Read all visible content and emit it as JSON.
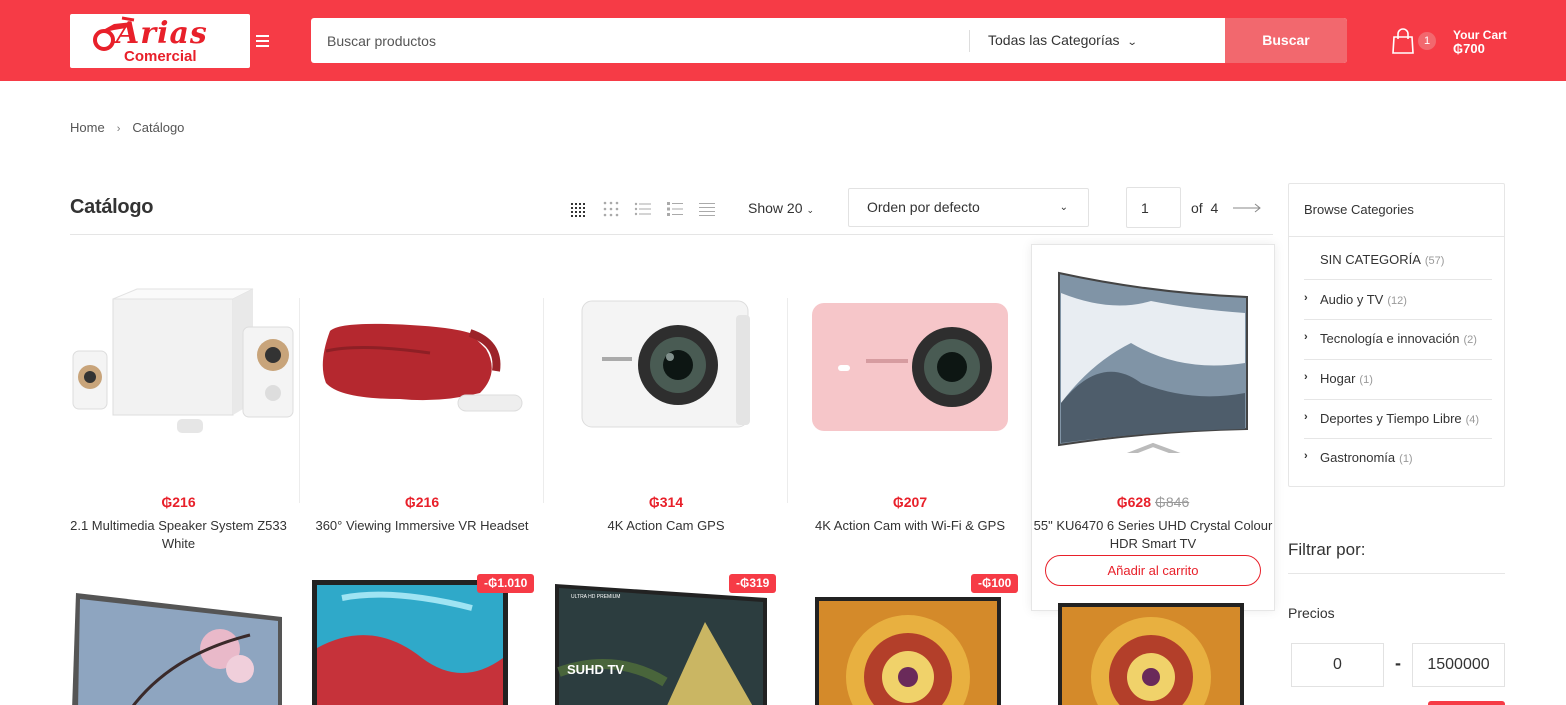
{
  "header": {
    "logo_text_1": "Arias",
    "logo_text_2": "Comercial",
    "search_placeholder": "Buscar productos",
    "category_select": "Todas las Categorías",
    "search_button": "Buscar",
    "cart_count": "1",
    "cart_label": "Your Cart",
    "cart_total": "₲700",
    "accent_color": "#f63b46"
  },
  "breadcrumb": {
    "home": "Home",
    "current": "Catálogo"
  },
  "toolbar": {
    "title": "Catálogo",
    "show": "Show 20",
    "sort": "Orden por defecto",
    "page_value": "1",
    "page_of": "of  4"
  },
  "products": [
    {
      "price": "₲216",
      "old_price": "",
      "name": "2.1 Multimedia Speaker System Z533 White"
    },
    {
      "price": "₲216",
      "old_price": "",
      "name": "360° Viewing Immersive VR Headset"
    },
    {
      "price": "₲314",
      "old_price": "",
      "name": "4K Action Cam GPS"
    },
    {
      "price": "₲207",
      "old_price": "",
      "name": "4K Action Cam with Wi-Fi & GPS"
    },
    {
      "price": "₲628",
      "old_price": "₲846",
      "name": "55\" KU6470 6 Series UHD Crystal Colour HDR Smart TV",
      "add_to_cart": "Añadir al carrito"
    }
  ],
  "row2_badges": [
    "-₲1.010",
    "-₲319",
    "-₲100"
  ],
  "row2_image_text": {
    "suhd": "SUHD TV",
    "ultra": "ULTRA HD PREMIUM"
  },
  "sidebar": {
    "browse_title": "Browse Categories",
    "categories": [
      {
        "label": "SIN CATEGORÍA",
        "count": "(57)"
      },
      {
        "label": "Audio y TV",
        "count": "(12)"
      },
      {
        "label": "Tecnología e innovación",
        "count": "(2)"
      },
      {
        "label": "Hogar",
        "count": "(1)"
      },
      {
        "label": "Deportes y Tiempo Libre",
        "count": "(4)"
      },
      {
        "label": "Gastronomía",
        "count": "(1)"
      }
    ],
    "filter_title": "Filtrar por:",
    "prices_label": "Precios",
    "price_min": "0",
    "price_max": "1500000"
  }
}
